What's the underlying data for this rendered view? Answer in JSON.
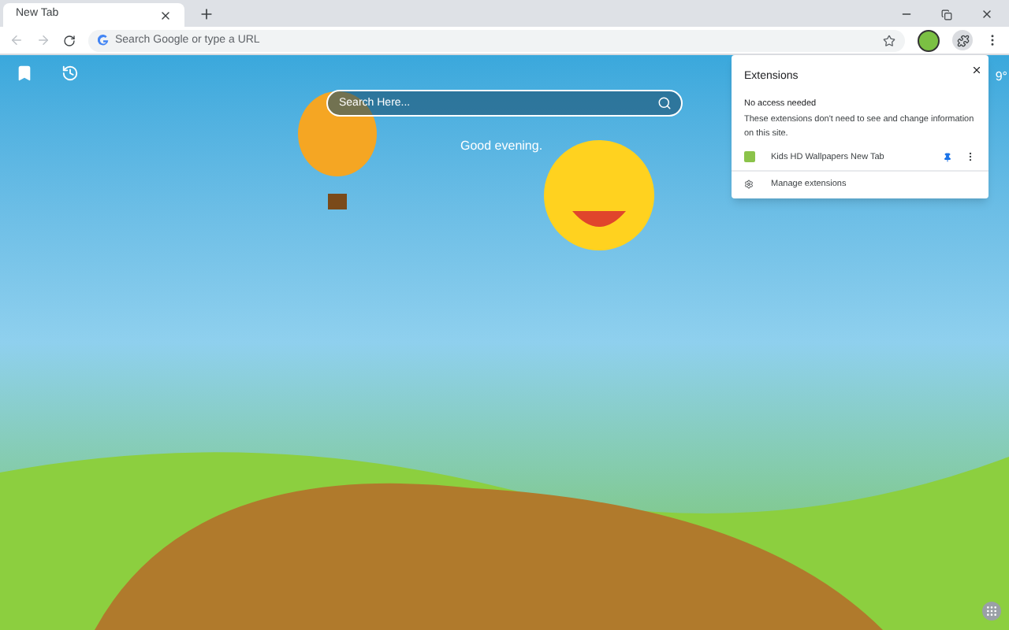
{
  "window": {
    "tab_title": "New Tab"
  },
  "toolbar": {
    "omnibox_placeholder": "Search Google or type a URL"
  },
  "page": {
    "search_placeholder": "Search Here...",
    "greeting": "Good evening.",
    "weather": "9°"
  },
  "extensions_popup": {
    "title": "Extensions",
    "section_title": "No access needed",
    "description": "These extensions don't need to see and change information on this site.",
    "extensions": [
      {
        "name": "Kids HD Wallpapers New Tab",
        "pinned": true
      }
    ],
    "manage_label": "Manage extensions"
  }
}
